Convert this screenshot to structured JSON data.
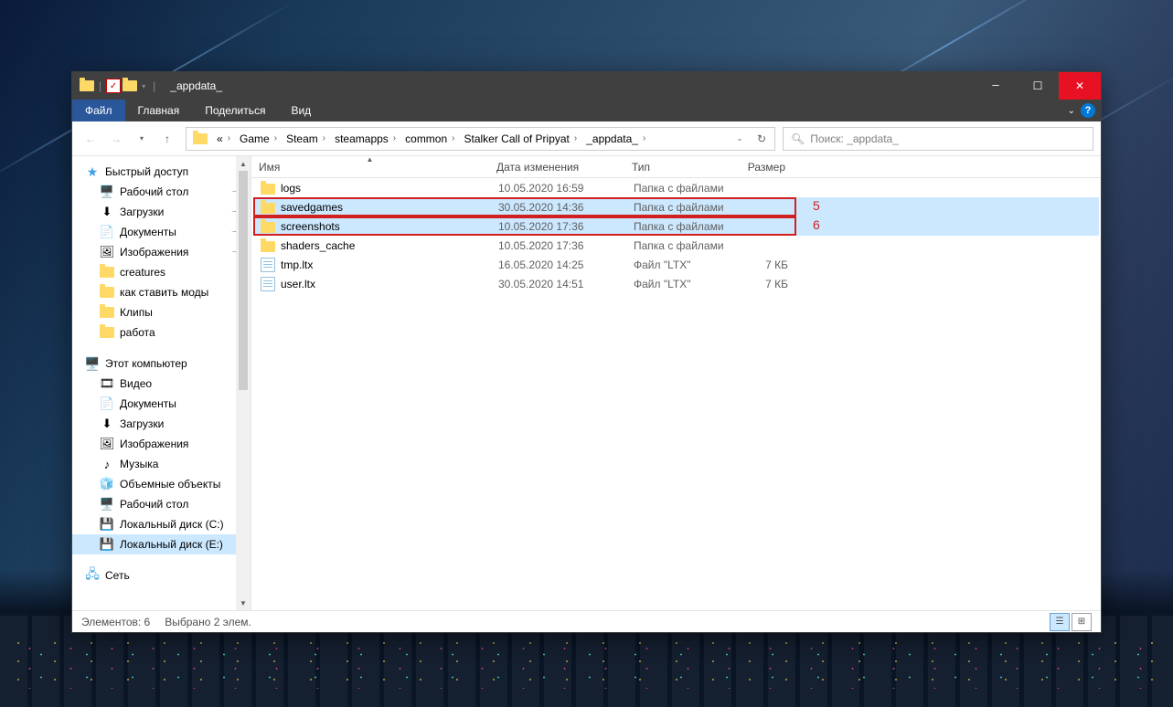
{
  "title": "_appdata_",
  "menu": {
    "file": "Файл",
    "home": "Главная",
    "share": "Поделиться",
    "view": "Вид"
  },
  "breadcrumb": [
    "Game",
    "Steam",
    "steamapps",
    "common",
    "Stalker Call of Pripyat",
    "_appdata_"
  ],
  "bc_prefix": "«",
  "search": {
    "placeholder": "Поиск: _appdata_"
  },
  "columns": {
    "name": "Имя",
    "date": "Дата изменения",
    "type": "Тип",
    "size": "Размер"
  },
  "sidebar": {
    "quick": {
      "label": "Быстрый доступ",
      "items": [
        {
          "label": "Рабочий стол",
          "icon": "desktop",
          "pinned": true
        },
        {
          "label": "Загрузки",
          "icon": "download",
          "pinned": true
        },
        {
          "label": "Документы",
          "icon": "doc",
          "pinned": true
        },
        {
          "label": "Изображения",
          "icon": "pic",
          "pinned": true
        },
        {
          "label": "creatures",
          "icon": "folder"
        },
        {
          "label": "как ставить моды",
          "icon": "folder"
        },
        {
          "label": "Клипы",
          "icon": "folder"
        },
        {
          "label": "работа",
          "icon": "folder"
        }
      ]
    },
    "pc": {
      "label": "Этот компьютер",
      "items": [
        {
          "label": "Видео",
          "icon": "video"
        },
        {
          "label": "Документы",
          "icon": "doc"
        },
        {
          "label": "Загрузки",
          "icon": "download"
        },
        {
          "label": "Изображения",
          "icon": "pic"
        },
        {
          "label": "Музыка",
          "icon": "music"
        },
        {
          "label": "Объемные объекты",
          "icon": "cube"
        },
        {
          "label": "Рабочий стол",
          "icon": "desktop"
        },
        {
          "label": "Локальный диск (C:)",
          "icon": "drive"
        },
        {
          "label": "Локальный диск (E:)",
          "icon": "drive",
          "selected": true
        }
      ]
    },
    "net": {
      "label": "Сеть"
    }
  },
  "files": [
    {
      "name": "logs",
      "icon": "folder",
      "date": "10.05.2020 16:59",
      "type": "Папка с файлами",
      "size": ""
    },
    {
      "name": "savedgames",
      "icon": "folder",
      "date": "30.05.2020 14:36",
      "type": "Папка с файлами",
      "size": "",
      "selected": true,
      "hl": "5"
    },
    {
      "name": "screenshots",
      "icon": "folder",
      "date": "10.05.2020 17:36",
      "type": "Папка с файлами",
      "size": "",
      "selected": true,
      "hl": "6"
    },
    {
      "name": "shaders_cache",
      "icon": "folder",
      "date": "10.05.2020 17:36",
      "type": "Папка с файлами",
      "size": ""
    },
    {
      "name": "tmp.ltx",
      "icon": "file",
      "date": "16.05.2020 14:25",
      "type": "Файл \"LTX\"",
      "size": "7 КБ"
    },
    {
      "name": "user.ltx",
      "icon": "file",
      "date": "30.05.2020 14:51",
      "type": "Файл \"LTX\"",
      "size": "7 КБ"
    }
  ],
  "status": {
    "count": "Элементов: 6",
    "selected": "Выбрано 2 элем."
  },
  "annotations": {
    "hl5": "5",
    "hl6": "6"
  }
}
